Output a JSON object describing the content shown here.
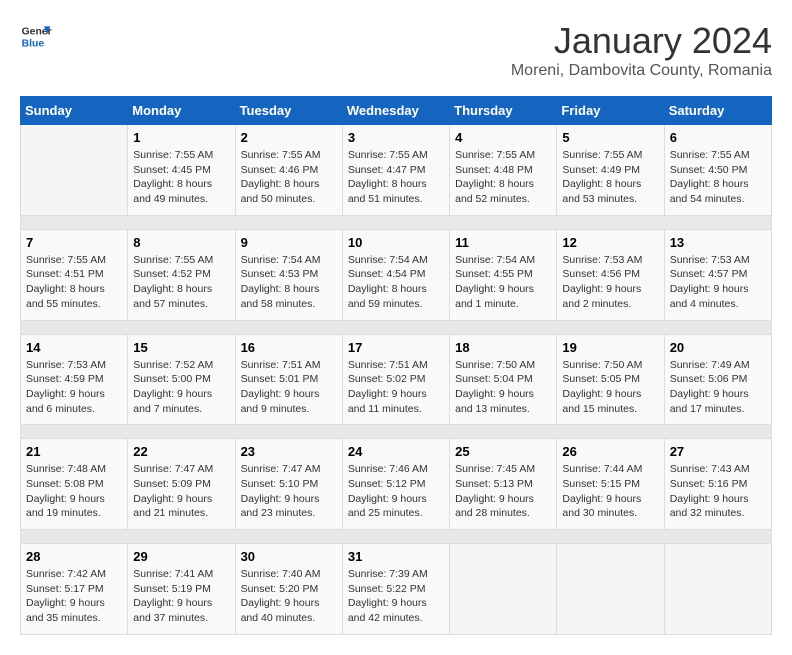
{
  "header": {
    "logo_line1": "General",
    "logo_line2": "Blue",
    "month": "January 2024",
    "location": "Moreni, Dambovita County, Romania"
  },
  "weekdays": [
    "Sunday",
    "Monday",
    "Tuesday",
    "Wednesday",
    "Thursday",
    "Friday",
    "Saturday"
  ],
  "weeks": [
    [
      {
        "day": "",
        "sunrise": "",
        "sunset": "",
        "daylight": ""
      },
      {
        "day": "1",
        "sunrise": "Sunrise: 7:55 AM",
        "sunset": "Sunset: 4:45 PM",
        "daylight": "Daylight: 8 hours and 49 minutes."
      },
      {
        "day": "2",
        "sunrise": "Sunrise: 7:55 AM",
        "sunset": "Sunset: 4:46 PM",
        "daylight": "Daylight: 8 hours and 50 minutes."
      },
      {
        "day": "3",
        "sunrise": "Sunrise: 7:55 AM",
        "sunset": "Sunset: 4:47 PM",
        "daylight": "Daylight: 8 hours and 51 minutes."
      },
      {
        "day": "4",
        "sunrise": "Sunrise: 7:55 AM",
        "sunset": "Sunset: 4:48 PM",
        "daylight": "Daylight: 8 hours and 52 minutes."
      },
      {
        "day": "5",
        "sunrise": "Sunrise: 7:55 AM",
        "sunset": "Sunset: 4:49 PM",
        "daylight": "Daylight: 8 hours and 53 minutes."
      },
      {
        "day": "6",
        "sunrise": "Sunrise: 7:55 AM",
        "sunset": "Sunset: 4:50 PM",
        "daylight": "Daylight: 8 hours and 54 minutes."
      }
    ],
    [
      {
        "day": "7",
        "sunrise": "Sunrise: 7:55 AM",
        "sunset": "Sunset: 4:51 PM",
        "daylight": "Daylight: 8 hours and 55 minutes."
      },
      {
        "day": "8",
        "sunrise": "Sunrise: 7:55 AM",
        "sunset": "Sunset: 4:52 PM",
        "daylight": "Daylight: 8 hours and 57 minutes."
      },
      {
        "day": "9",
        "sunrise": "Sunrise: 7:54 AM",
        "sunset": "Sunset: 4:53 PM",
        "daylight": "Daylight: 8 hours and 58 minutes."
      },
      {
        "day": "10",
        "sunrise": "Sunrise: 7:54 AM",
        "sunset": "Sunset: 4:54 PM",
        "daylight": "Daylight: 8 hours and 59 minutes."
      },
      {
        "day": "11",
        "sunrise": "Sunrise: 7:54 AM",
        "sunset": "Sunset: 4:55 PM",
        "daylight": "Daylight: 9 hours and 1 minute."
      },
      {
        "day": "12",
        "sunrise": "Sunrise: 7:53 AM",
        "sunset": "Sunset: 4:56 PM",
        "daylight": "Daylight: 9 hours and 2 minutes."
      },
      {
        "day": "13",
        "sunrise": "Sunrise: 7:53 AM",
        "sunset": "Sunset: 4:57 PM",
        "daylight": "Daylight: 9 hours and 4 minutes."
      }
    ],
    [
      {
        "day": "14",
        "sunrise": "Sunrise: 7:53 AM",
        "sunset": "Sunset: 4:59 PM",
        "daylight": "Daylight: 9 hours and 6 minutes."
      },
      {
        "day": "15",
        "sunrise": "Sunrise: 7:52 AM",
        "sunset": "Sunset: 5:00 PM",
        "daylight": "Daylight: 9 hours and 7 minutes."
      },
      {
        "day": "16",
        "sunrise": "Sunrise: 7:51 AM",
        "sunset": "Sunset: 5:01 PM",
        "daylight": "Daylight: 9 hours and 9 minutes."
      },
      {
        "day": "17",
        "sunrise": "Sunrise: 7:51 AM",
        "sunset": "Sunset: 5:02 PM",
        "daylight": "Daylight: 9 hours and 11 minutes."
      },
      {
        "day": "18",
        "sunrise": "Sunrise: 7:50 AM",
        "sunset": "Sunset: 5:04 PM",
        "daylight": "Daylight: 9 hours and 13 minutes."
      },
      {
        "day": "19",
        "sunrise": "Sunrise: 7:50 AM",
        "sunset": "Sunset: 5:05 PM",
        "daylight": "Daylight: 9 hours and 15 minutes."
      },
      {
        "day": "20",
        "sunrise": "Sunrise: 7:49 AM",
        "sunset": "Sunset: 5:06 PM",
        "daylight": "Daylight: 9 hours and 17 minutes."
      }
    ],
    [
      {
        "day": "21",
        "sunrise": "Sunrise: 7:48 AM",
        "sunset": "Sunset: 5:08 PM",
        "daylight": "Daylight: 9 hours and 19 minutes."
      },
      {
        "day": "22",
        "sunrise": "Sunrise: 7:47 AM",
        "sunset": "Sunset: 5:09 PM",
        "daylight": "Daylight: 9 hours and 21 minutes."
      },
      {
        "day": "23",
        "sunrise": "Sunrise: 7:47 AM",
        "sunset": "Sunset: 5:10 PM",
        "daylight": "Daylight: 9 hours and 23 minutes."
      },
      {
        "day": "24",
        "sunrise": "Sunrise: 7:46 AM",
        "sunset": "Sunset: 5:12 PM",
        "daylight": "Daylight: 9 hours and 25 minutes."
      },
      {
        "day": "25",
        "sunrise": "Sunrise: 7:45 AM",
        "sunset": "Sunset: 5:13 PM",
        "daylight": "Daylight: 9 hours and 28 minutes."
      },
      {
        "day": "26",
        "sunrise": "Sunrise: 7:44 AM",
        "sunset": "Sunset: 5:15 PM",
        "daylight": "Daylight: 9 hours and 30 minutes."
      },
      {
        "day": "27",
        "sunrise": "Sunrise: 7:43 AM",
        "sunset": "Sunset: 5:16 PM",
        "daylight": "Daylight: 9 hours and 32 minutes."
      }
    ],
    [
      {
        "day": "28",
        "sunrise": "Sunrise: 7:42 AM",
        "sunset": "Sunset: 5:17 PM",
        "daylight": "Daylight: 9 hours and 35 minutes."
      },
      {
        "day": "29",
        "sunrise": "Sunrise: 7:41 AM",
        "sunset": "Sunset: 5:19 PM",
        "daylight": "Daylight: 9 hours and 37 minutes."
      },
      {
        "day": "30",
        "sunrise": "Sunrise: 7:40 AM",
        "sunset": "Sunset: 5:20 PM",
        "daylight": "Daylight: 9 hours and 40 minutes."
      },
      {
        "day": "31",
        "sunrise": "Sunrise: 7:39 AM",
        "sunset": "Sunset: 5:22 PM",
        "daylight": "Daylight: 9 hours and 42 minutes."
      },
      {
        "day": "",
        "sunrise": "",
        "sunset": "",
        "daylight": ""
      },
      {
        "day": "",
        "sunrise": "",
        "sunset": "",
        "daylight": ""
      },
      {
        "day": "",
        "sunrise": "",
        "sunset": "",
        "daylight": ""
      }
    ]
  ]
}
